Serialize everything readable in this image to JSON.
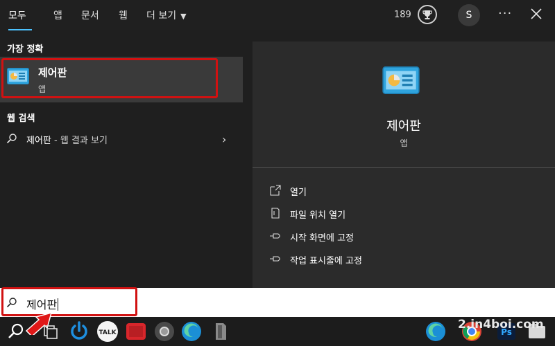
{
  "tabs": [
    {
      "label": "모두",
      "active": true
    },
    {
      "label": "앱",
      "active": false
    },
    {
      "label": "문서",
      "active": false
    },
    {
      "label": "웹",
      "active": false
    }
  ],
  "more_tab": {
    "label": "더 보기"
  },
  "header": {
    "points": "189",
    "avatar_initial": "S"
  },
  "left": {
    "best_match_heading": "가장 정확",
    "best_match": {
      "name": "제어판",
      "type": "앱"
    },
    "web_search_heading": "웹 검색",
    "web_result": {
      "query": "제어판",
      "suffix": " - 웹 결과 보기"
    }
  },
  "detail": {
    "name": "제어판",
    "type": "앱",
    "actions": [
      {
        "label": "열기",
        "icon": "open-icon"
      },
      {
        "label": "파일 위치 열기",
        "icon": "file-location-icon"
      },
      {
        "label": "시작 화면에 고정",
        "icon": "pin-icon"
      },
      {
        "label": "작업 표시줄에 고정",
        "icon": "pin-icon"
      }
    ]
  },
  "search": {
    "value": "제어판"
  },
  "taskbar": {
    "apps": [
      "search-icon",
      "task-view-icon",
      "power-icon",
      "kakaotalk-icon",
      "youtube-icon",
      "chrome-icon",
      "edge-icon",
      "app-icon",
      "edge-icon",
      "chrome-icon",
      "photoshop-icon",
      "files-icon"
    ],
    "kakaotalk_label": "TALK",
    "photoshop_label": "Ps"
  },
  "watermark": "2.in4boi.com",
  "colors": {
    "accent": "#4cc2ff",
    "highlight_box": "#d11111",
    "panel": "#2b2b2b",
    "background": "#1f1f1f"
  }
}
